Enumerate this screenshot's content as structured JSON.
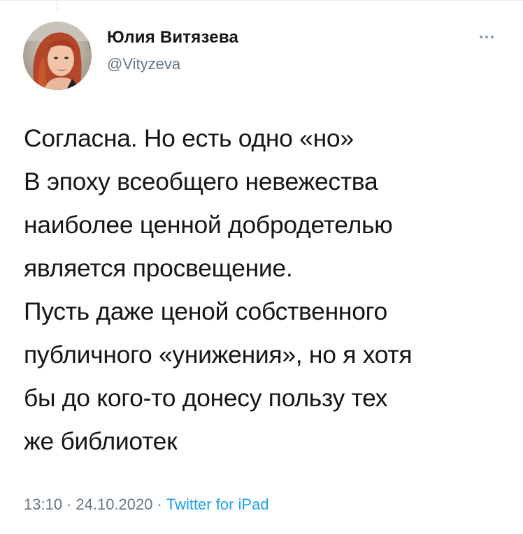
{
  "author": {
    "display_name": "Юлия Витязева",
    "handle": "@Vityzeva"
  },
  "icons": {
    "more": "more-horizontal-icon",
    "avatar": "profile-photo"
  },
  "tweet": {
    "lines": [
      "Согласна. Но есть одно «но»",
      "В эпоху всеобщего невежества",
      "наиболее ценной добродетелью",
      "является просвещение.",
      "Пусть даже ценой собственного",
      "публичного «унижения», но я хотя",
      "бы до кого-то донесу пользу тех",
      "же библиотек"
    ]
  },
  "meta": {
    "time": "13:10",
    "separator": "·",
    "date": "24.10.2020",
    "source": "Twitter for iPad"
  },
  "colors": {
    "text": "#14171a",
    "secondary": "#657786",
    "link": "#1da1f2"
  }
}
